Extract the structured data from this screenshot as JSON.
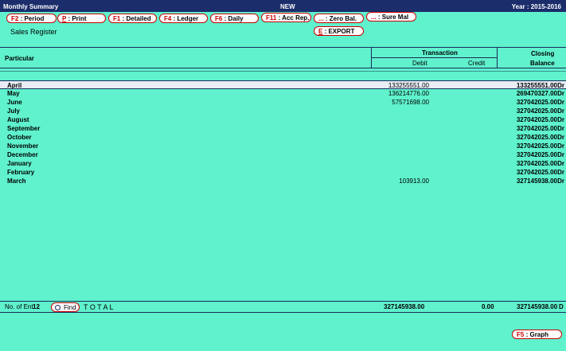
{
  "titlebar": {
    "left": "Monthly Summary",
    "center": "NEW",
    "right": "Year : 2015-2016"
  },
  "toolbar": [
    {
      "key": "F2",
      "label": ": Period"
    },
    {
      "key": "P",
      "label": ": Print"
    },
    {
      "key": "F1",
      "label": ": Detailed"
    },
    {
      "key": "F4",
      "label": ": Ledger"
    },
    {
      "key": "F6",
      "label": ": Daily"
    },
    {
      "key": "F11",
      "label": ": Acc Rep."
    },
    {
      "key": "...",
      "label": ": Zero Bal."
    },
    {
      "key": "...",
      "label": ": Sure Mal"
    }
  ],
  "export_button": {
    "key": "E",
    "label": ": EXPORT"
  },
  "subtitle": "Sales Register",
  "table": {
    "col_particular": "Particular",
    "col_transaction": "Transaction",
    "col_debit": "Debit",
    "col_credit": "Credit",
    "col_closing_1": "Closing",
    "col_closing_2": "Balance",
    "rows": [
      {
        "month": "April",
        "debit": "133255551.00",
        "closing": "133255551.00",
        "suffix": "Dr"
      },
      {
        "month": "May",
        "debit": "136214776.00",
        "closing": "269470327.00",
        "suffix": "Dr"
      },
      {
        "month": "June",
        "debit": "57571698.00",
        "closing": "327042025.00",
        "suffix": "Dr"
      },
      {
        "month": "July",
        "debit": "",
        "closing": "327042025.00",
        "suffix": "Dr"
      },
      {
        "month": "August",
        "debit": "",
        "closing": "327042025.00",
        "suffix": "Dr"
      },
      {
        "month": "September",
        "debit": "",
        "closing": "327042025.00",
        "suffix": "Dr"
      },
      {
        "month": "October",
        "debit": "",
        "closing": "327042025.00",
        "suffix": "Dr"
      },
      {
        "month": "November",
        "debit": "",
        "closing": "327042025.00",
        "suffix": "Dr"
      },
      {
        "month": "December",
        "debit": "",
        "closing": "327042025.00",
        "suffix": "Dr"
      },
      {
        "month": "January",
        "debit": "",
        "closing": "327042025.00",
        "suffix": "Dr"
      },
      {
        "month": "February",
        "debit": "",
        "closing": "327042025.00",
        "suffix": "Dr"
      },
      {
        "month": "March",
        "debit": "103913.00",
        "closing": "327145938.00",
        "suffix": "Dr"
      }
    ]
  },
  "footer": {
    "entries_label": "No. of Ent.",
    "entries_count": "12",
    "find_label": "Find",
    "total_label": "T O T A L",
    "total_debit": "327145938.00",
    "total_credit": "0.00",
    "total_closing": "327145938.00",
    "total_suffix": "D"
  },
  "graph_button": {
    "key": "F5",
    "label": ": Graph"
  }
}
